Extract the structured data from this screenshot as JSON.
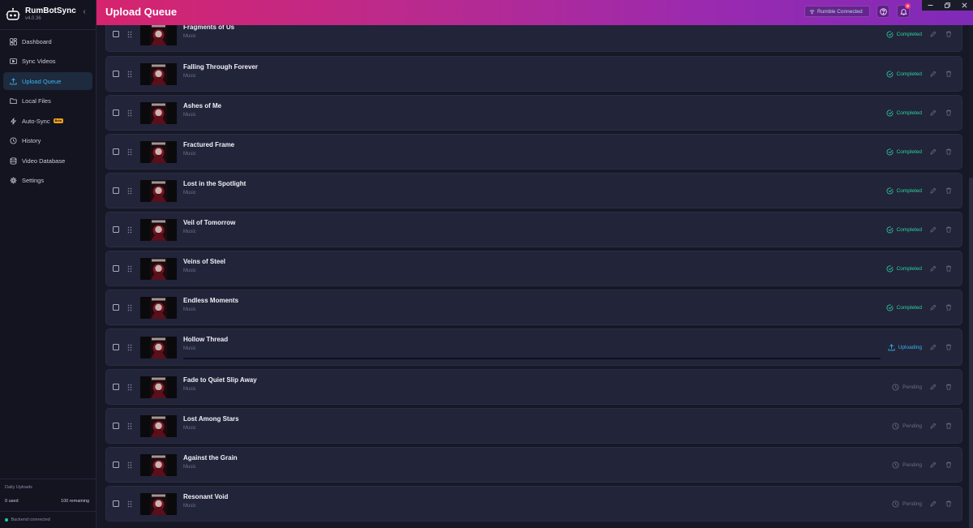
{
  "app": {
    "name": "RumBotSync",
    "version": "v4.0.36"
  },
  "sidebar": {
    "items": [
      {
        "label": "Dashboard",
        "icon": "dashboard-icon",
        "active": false
      },
      {
        "label": "Sync Videos",
        "icon": "video-icon",
        "active": false
      },
      {
        "label": "Upload Queue",
        "icon": "upload-icon",
        "active": true
      },
      {
        "label": "Local Files",
        "icon": "folder-icon",
        "active": false
      },
      {
        "label": "Auto-Sync",
        "icon": "lightning-icon",
        "active": false,
        "badge": "Beta"
      },
      {
        "label": "History",
        "icon": "history-icon",
        "active": false
      },
      {
        "label": "Video Database",
        "icon": "database-icon",
        "active": false
      },
      {
        "label": "Settings",
        "icon": "gear-icon",
        "active": false
      }
    ],
    "daily_uploads": {
      "title": "Daily Uploads",
      "used": "0 used",
      "remaining": "100 remaining"
    },
    "backend_status": "Backend connected"
  },
  "header": {
    "title": "Upload Queue",
    "connection": "Rumble Connected",
    "notification_count": "8"
  },
  "colors": {
    "completed": "#2bd39a",
    "uploading": "#3bb4f0",
    "pending": "#6b6d85",
    "accent": "#39b6f2"
  },
  "queue": [
    {
      "title": "Fragments of Us",
      "category": "Music",
      "status": "Completed"
    },
    {
      "title": "Falling Through Forever",
      "category": "Music",
      "status": "Completed"
    },
    {
      "title": "Ashes of Me",
      "category": "Music",
      "status": "Completed"
    },
    {
      "title": "Fractured Frame",
      "category": "Music",
      "status": "Completed"
    },
    {
      "title": "Lost in the Spotlight",
      "category": "Music",
      "status": "Completed"
    },
    {
      "title": "Veil of Tomorrow",
      "category": "Music",
      "status": "Completed"
    },
    {
      "title": "Veins of Steel",
      "category": "Music",
      "status": "Completed"
    },
    {
      "title": "Endless Moments",
      "category": "Music",
      "status": "Completed"
    },
    {
      "title": "Hollow Thread",
      "category": "Music",
      "status": "Uploading",
      "progress": 1.0
    },
    {
      "title": "Fade to Quiet Slip Away",
      "category": "Music",
      "status": "Pending"
    },
    {
      "title": "Lost Among Stars",
      "category": "Music",
      "status": "Pending"
    },
    {
      "title": "Against the Grain",
      "category": "Music",
      "status": "Pending"
    },
    {
      "title": "Resonant Void",
      "category": "Music",
      "status": "Pending"
    }
  ]
}
